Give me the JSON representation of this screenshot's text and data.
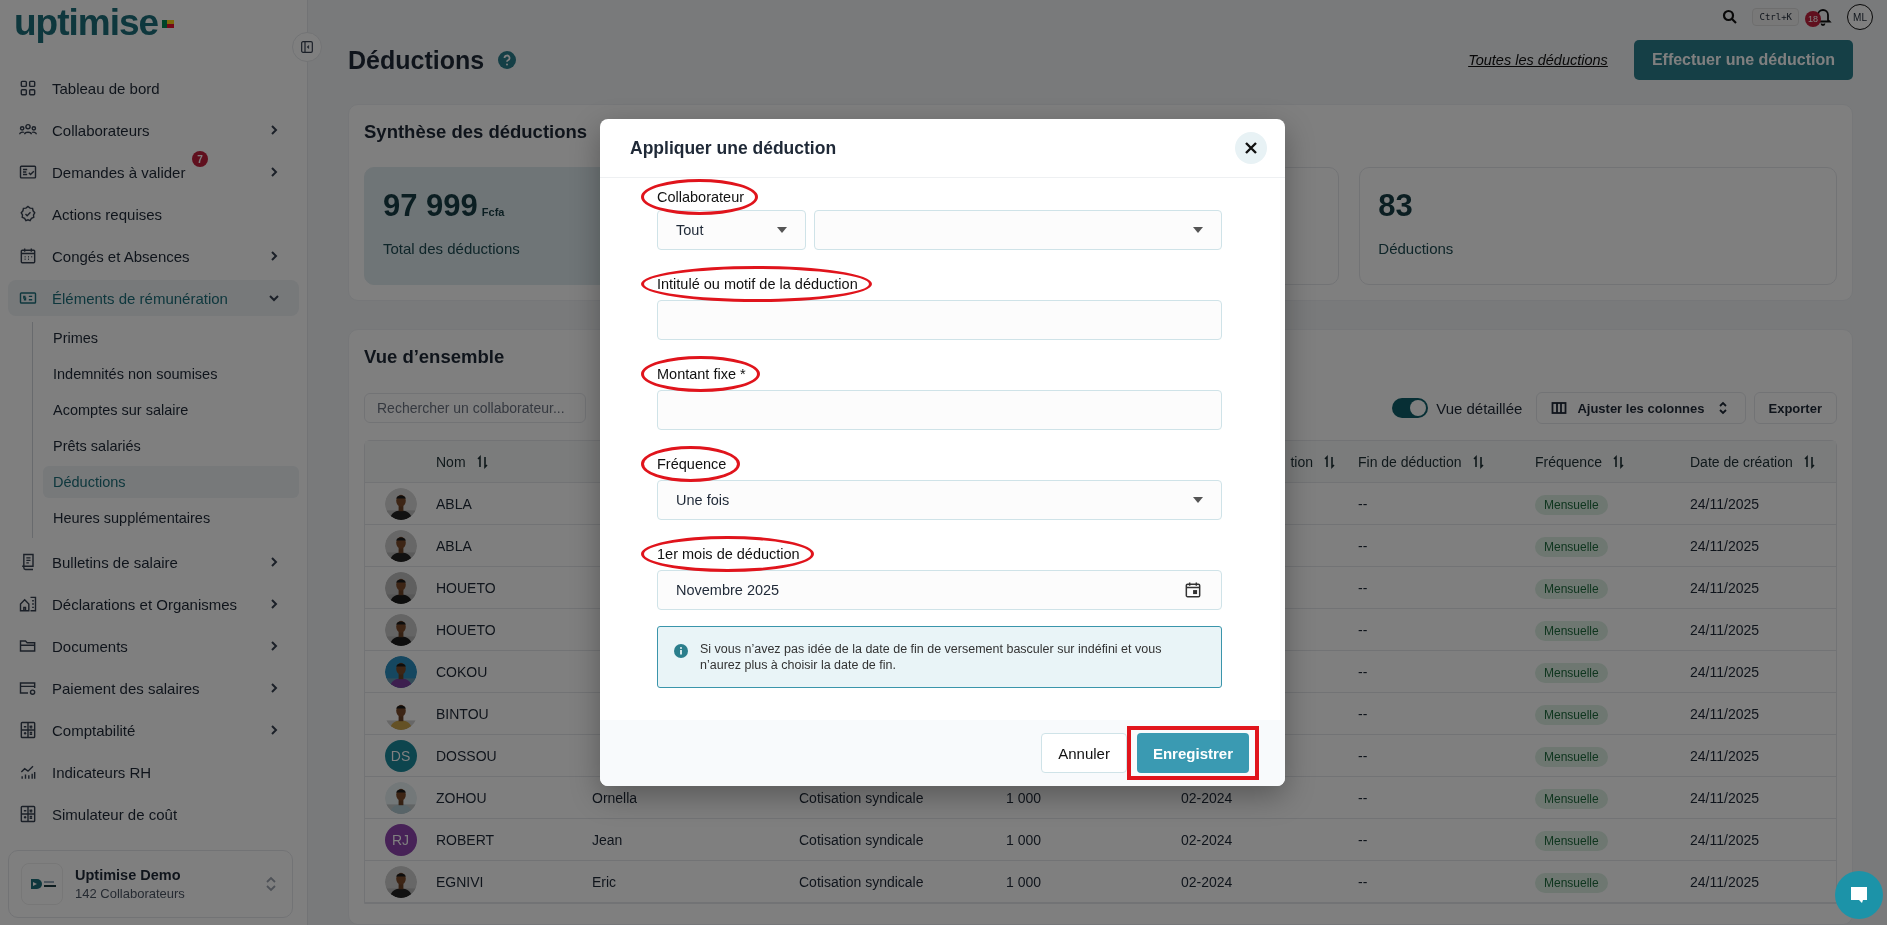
{
  "brand": {
    "name": "uptimise"
  },
  "sidebar": {
    "items": [
      {
        "label": "Tableau de bord",
        "selected": false
      },
      {
        "label": "Collaborateurs",
        "selected": false,
        "expanded": false
      },
      {
        "label": "Demandes à valider",
        "selected": false,
        "expanded": false,
        "badge": "7"
      },
      {
        "label": "Actions requises",
        "selected": false
      },
      {
        "label": "Congés et Absences",
        "selected": false,
        "expanded": false
      },
      {
        "label": "Éléments de rémunération",
        "selected": true,
        "expanded": true,
        "children": [
          {
            "label": "Primes",
            "selected": false
          },
          {
            "label": "Indemnités non soumises",
            "selected": false
          },
          {
            "label": "Acomptes sur salaire",
            "selected": false
          },
          {
            "label": "Prêts salariés",
            "selected": false
          },
          {
            "label": "Déductions",
            "selected": true
          },
          {
            "label": "Heures supplémentaires",
            "selected": false
          }
        ]
      },
      {
        "label": "Bulletins de salaire",
        "selected": false,
        "expanded": false
      },
      {
        "label": "Déclarations et Organismes",
        "selected": false,
        "expanded": false
      },
      {
        "label": "Documents",
        "selected": false,
        "expanded": false
      },
      {
        "label": "Paiement des salaires",
        "selected": false,
        "expanded": false
      },
      {
        "label": "Comptabilité",
        "selected": false,
        "expanded": false
      },
      {
        "label": "Indicateurs RH",
        "selected": false
      },
      {
        "label": "Simulateur de coût",
        "selected": false
      }
    ],
    "organization": {
      "name": "Uptimise Demo",
      "members": "142 Collaborateurs"
    }
  },
  "topbar": {
    "shortcut": "Ctrl+K",
    "notifications": "18",
    "user_initials": "ML"
  },
  "page": {
    "title": "Déductions",
    "link": "Toutes les déductions",
    "primary_button": "Effectuer une déduction"
  },
  "summary": {
    "title": "Synthèse des déductions",
    "cards": [
      {
        "value": "97 999",
        "unit": "Fcfa",
        "label": "Total des déductions",
        "highlighted": true
      },
      {
        "highlighted": false
      },
      {
        "value": "83",
        "label": "Déductions",
        "highlighted": false
      }
    ]
  },
  "overview": {
    "title": "Vue d’ensemble",
    "search_placeholder": "Rechercher un collaborateur...",
    "detailed_view": {
      "label": "Vue détaillée",
      "on": true
    },
    "columns_button": "Ajuster les colonnes",
    "export_button": "Exporter"
  },
  "table": {
    "columns": [
      "Nom",
      "tion",
      "Fin de déduction",
      "Fréquence",
      "Date de création"
    ],
    "rows": [
      {
        "nom": "ABLA",
        "fin": "--",
        "frequence": "Mensuelle",
        "date": "24/11/2025"
      },
      {
        "nom": "ABLA",
        "fin": "--",
        "frequence": "Mensuelle",
        "date": "24/11/2025"
      },
      {
        "nom": "HOUETO",
        "fin": "--",
        "frequence": "Mensuelle",
        "date": "24/11/2025"
      },
      {
        "nom": "HOUETO",
        "fin": "--",
        "frequence": "Mensuelle",
        "date": "24/11/2025"
      },
      {
        "nom": "COKOU",
        "fin": "--",
        "frequence": "Mensuelle",
        "date": "24/11/2025"
      },
      {
        "nom": "BINTOU",
        "fin": "--",
        "frequence": "Mensuelle",
        "date": "24/11/2025"
      },
      {
        "avatar": {
          "kind": "initials",
          "initials": "DS",
          "color": "#0d454e"
        },
        "nom": "DOSSOU",
        "fin": "--",
        "frequence": "Mensuelle",
        "date": "24/11/2025"
      },
      {
        "nom": "ZOHOU",
        "prenom": "Ornella",
        "intitule": "Cotisation syndicale",
        "montant": "1 000",
        "debut": "02-2024",
        "fin": "--",
        "frequence": "Mensuelle",
        "date": "24/11/2025"
      },
      {
        "avatar": {
          "kind": "initials",
          "initials": "RJ",
          "color": "#472257"
        },
        "nom": "ROBERT",
        "prenom": "Jean",
        "intitule": "Cotisation syndicale",
        "montant": "1 000",
        "debut": "02-2024",
        "fin": "--",
        "frequence": "Mensuelle",
        "date": "24/11/2025"
      },
      {
        "nom": "EGNIVI",
        "prenom": "Eric",
        "intitule": "Cotisation syndicale",
        "montant": "1 000",
        "debut": "02-2024",
        "fin": "--",
        "frequence": "Mensuelle",
        "date": "24/11/2025"
      }
    ]
  },
  "modal": {
    "title": "Appliquer une déduction",
    "fields": [
      {
        "kind": "double-select",
        "label": "Collaborateur",
        "value": "Tout",
        "highlighted": true
      },
      {
        "kind": "text",
        "label": "Intitulé ou motif de la déduction",
        "highlighted": true
      },
      {
        "kind": "text",
        "label": "Montant fixe *",
        "highlighted": true
      },
      {
        "kind": "select",
        "label": "Fréquence",
        "value": "Une fois",
        "highlighted": true
      },
      {
        "kind": "date",
        "label": "1er mois de déduction",
        "value": "Novembre 2025",
        "highlighted": true
      }
    ],
    "info": "Si vous n’avez pas idée de la date de fin de versement basculer sur indéfini et vous n’aurez plus à choisir la date de fin.",
    "buttons": [
      {
        "label": "Annuler",
        "kind": "secondary",
        "highlighted": false
      },
      {
        "label": "Enregistrer",
        "kind": "primary",
        "highlighted": true
      }
    ]
  }
}
